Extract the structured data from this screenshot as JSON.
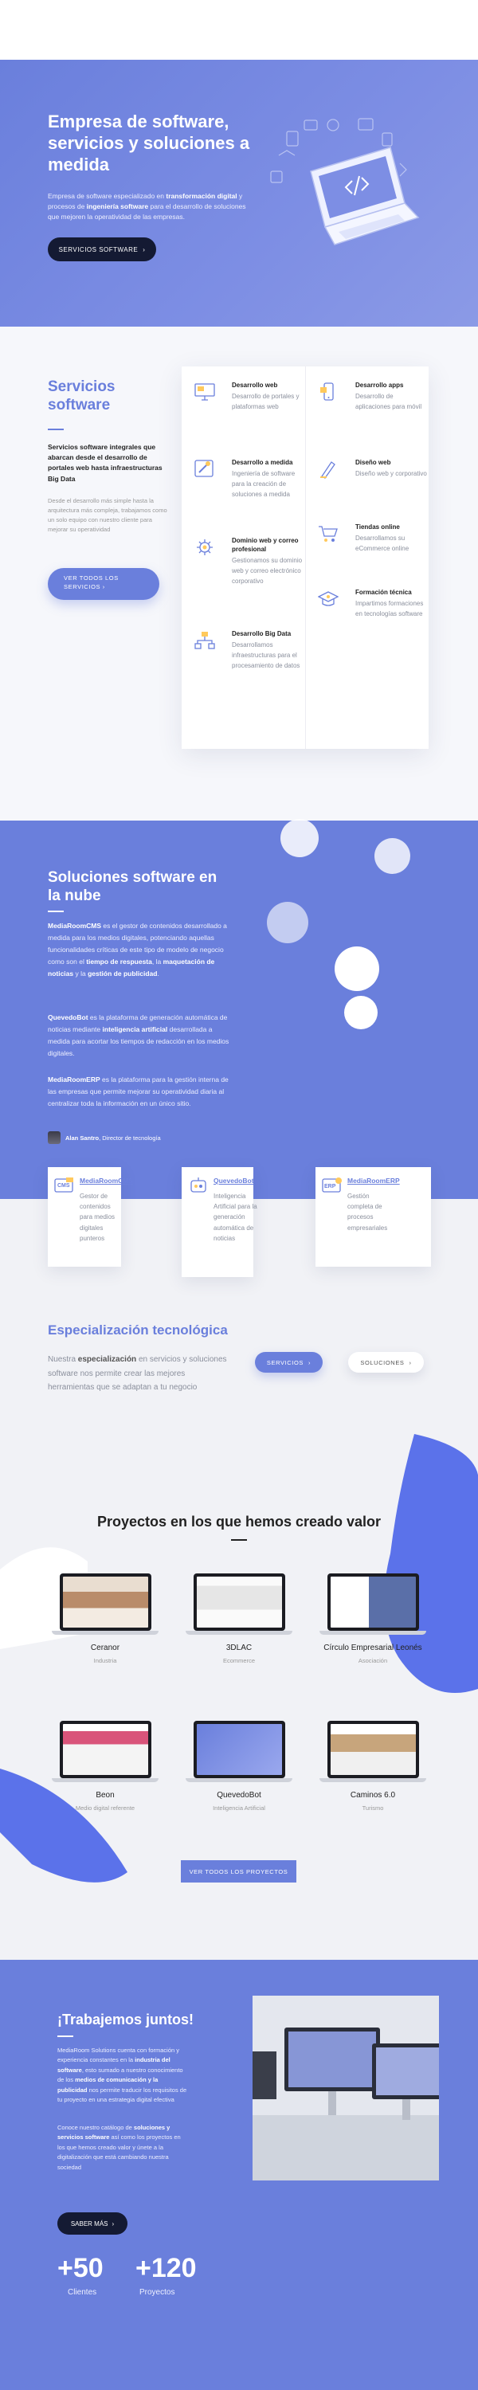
{
  "colors": {
    "accent": "#6a7fdc",
    "dark": "#141a33",
    "card": "#ffffff",
    "muted": "#8a8f9c"
  },
  "hero": {
    "title": "Empresa de software, servicios y soluciones a medida",
    "desc_1": "Empresa de software especializado en ",
    "desc_b1": "transformación digital",
    "desc_2": " y procesos de ",
    "desc_b2": "ingeniería software",
    "desc_3": " para el desarrollo de soluciones que mejoren la operatividad de las empresas.",
    "button": "SERVICIOS SOFTWARE",
    "button_icon": "arrow-right-icon"
  },
  "services": {
    "title": "Servicios software",
    "lead": "Servicios software integrales que abarcan desde el desarrollo de portales web hasta infraestructuras Big Data",
    "sub": "Desde el desarrollo más simple hasta la arquitectura más compleja, trabajamos como un solo equipo con nuestro cliente para mejorar su operatividad",
    "button": "VER TODOS LOS SERVICIOS",
    "items": [
      {
        "name": "Desarrollo web",
        "desc": "Desarrollo de portales y plataformas web",
        "icon": "monitor-icon"
      },
      {
        "name": "Desarrollo apps",
        "desc": "Desarrollo de aplicaciones para móvil",
        "icon": "mobile-icon"
      },
      {
        "name": "Desarrollo a medida",
        "desc": "Ingeniería de software para la creación de soluciones a medida",
        "icon": "tools-icon"
      },
      {
        "name": "Diseño web",
        "desc": "Diseño web y corporativo",
        "icon": "pen-icon"
      },
      {
        "name": "Dominio web y correo profesional",
        "desc": "Gestionamos su dominio web y correo electrónico corporativo",
        "icon": "gear-icon"
      },
      {
        "name": "Tiendas online",
        "desc": "Desarrollamos su eCommerce online",
        "icon": "cart-icon"
      },
      {
        "name": "Desarrollo Big Data",
        "desc": "Desarrollamos infraestructuras para el procesamiento de datos",
        "icon": "network-icon"
      },
      {
        "name": "Formación técnica",
        "desc": "Impartimos formaciones en tecnologías software",
        "icon": "graduation-cap-icon"
      }
    ]
  },
  "cloud": {
    "title": "Soluciones software en la nube",
    "p1_b1": "MediaRoomCMS",
    "p1_1": " es el gestor de contenidos desarrollado a medida para los medios digitales, potenciando aquellas funcionalidades críticas de este tipo de modelo de negocio como son el ",
    "p1_b2": "tiempo de respuesta",
    "p1_2": ", la ",
    "p1_b3": "maquetación de noticias",
    "p1_3": " y la ",
    "p1_b4": "gestión de publicidad",
    "p1_4": ".",
    "p2_b1": "QuevedoBot",
    "p2_1": " es la plataforma de generación automática de noticias mediante ",
    "p2_b2": "inteligencia artificial",
    "p2_2": " desarrollada a medida para acortar los tiempos de redacción en los medios digitales.",
    "p3_b1": "MediaRoomERP",
    "p3_1": " es la plataforma para la gestión interna de las empresas que permite mejorar su operatividad diaria al centralizar toda la información en un único sitio.",
    "author_name": "Alan Santro",
    "author_role": ", Director de tecnología",
    "products": [
      {
        "name": "MediaRoomCMS",
        "desc": "Gestor de contenidos para medios digitales punteros",
        "icon": "cms-icon"
      },
      {
        "name": "QuevedoBot",
        "desc": "Inteligencia Artificial para la generación automática de noticias",
        "icon": "robot-icon"
      },
      {
        "name": "MediaRoomERP",
        "desc": "Gestión completa de procesos empresariales",
        "icon": "erp-icon"
      }
    ]
  },
  "spec": {
    "title": "Especialización tecnológica",
    "desc_1": "Nuestra ",
    "desc_b": "especialización",
    "desc_2": " en servicios y soluciones software nos permite crear las mejores herramientas que se adaptan a tu negocio",
    "pill_servicios": "SERVICIOS",
    "pill_soluciones": "SOLUCIONES"
  },
  "projects": {
    "title": "Proyectos en los que hemos creado valor",
    "button": "VER TODOS LOS PROYECTOS",
    "items": [
      {
        "name": "Ceranor",
        "category": "Industria"
      },
      {
        "name": "3DLAC",
        "category": "Ecommerce"
      },
      {
        "name": "Círculo Empresarial Leonés",
        "category": "Asociación"
      },
      {
        "name": "Beon",
        "category": "Medio digital referente"
      },
      {
        "name": "QuevedoBot",
        "category": "Inteligencia Artificial"
      },
      {
        "name": "Caminos 6.0",
        "category": "Turismo"
      }
    ]
  },
  "cta": {
    "title": "¡Trabajemos juntos!",
    "p1_1": "MediaRoom Solutions cuenta con formación y experiencia constantes en la ",
    "p1_b1": "industria del software",
    "p1_2": ", esto sumado a nuestro conocimiento de los ",
    "p1_b2": "medios de comunicación y la publicidad",
    "p1_3": " nos permite traducir los requisitos de tu proyecto en una estrategia digital efectiva",
    "p2_1": "Conoce nuestro catálogo de ",
    "p2_b1": "soluciones y servicios software",
    "p2_2": " así como los proyectos en los que hemos creado valor y únete a la digitalización que está cambiando nuestra sociedad",
    "button": "SABER MÁS",
    "stats": [
      {
        "value": "+50",
        "label": "Clientes"
      },
      {
        "value": "+120",
        "label": "Proyectos"
      }
    ]
  }
}
